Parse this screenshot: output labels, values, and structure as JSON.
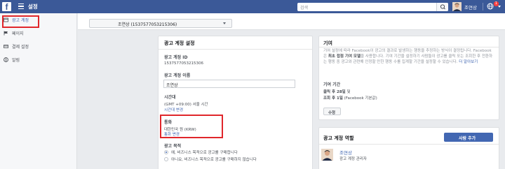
{
  "topbar": {
    "logo": "f",
    "title": "설정",
    "search_placeholder": "검색",
    "user_name": "조연상",
    "notification_count": "1",
    "brand_color": "#3b5998"
  },
  "sidebar": {
    "items": [
      {
        "label": "광고 계정",
        "icon": "ad-account-icon"
      },
      {
        "label": "페이지",
        "icon": "flag-icon"
      },
      {
        "label": "결제 설정",
        "icon": "payment-icon"
      },
      {
        "label": "알림",
        "icon": "globe-icon"
      }
    ],
    "highlight_color": "#e0262b"
  },
  "account_selector": {
    "label": "조연상 (1537577053215306)"
  },
  "account_settings": {
    "title": "광고 계정 설정",
    "account_id_label": "광고 계정 ID",
    "account_id_value": "1537577053215306",
    "account_name_label": "광고 계정 이름",
    "account_name_value": "조연상",
    "timezone_label": "시간대",
    "timezone_value": "(GMT +09:00) 서울 시간",
    "timezone_link": "시간대 변경",
    "currency_label": "통화",
    "currency_value": "대한민국 원 (KRW)",
    "currency_link": "통화 변경",
    "purpose_label": "광고 목적",
    "purpose_options": [
      "예, 비즈니스 목적으로 광고를 구매합니다",
      "아니요, 비즈니스 목적으로 광고를 구매하지 않습니다"
    ],
    "purpose_selected": 0
  },
  "attribution": {
    "title": "기여",
    "description_before": "기여 설정에 따라 Facebook이 광고의 결과로 발생하는 행동을 추정하는 방식이 결정됩니다. Facebook은 ",
    "description_bold": "최초 접점 기여 모델",
    "description_after": "을 사용합니다. 기여 기간을 설정하기 사람들이 광고를 클릭 또는 조회한 후 전환하는 행동 중 광고와 관련해 인정할 만한 행동 수를 집계할 기간을 설정할 수 있습니다.",
    "description_link": "더 알아보기",
    "window_label": "기여 기간",
    "click_line_bold": "클릭 후 28일",
    "click_line_rest": " 및",
    "view_line_bold": "조회 후 1일",
    "view_line_rest": " (Facebook 기본값)",
    "edit_button": "수정"
  },
  "roles": {
    "title": "광고 계정 역할",
    "add_button": "사람 추가",
    "members": [
      {
        "name": "조연상",
        "role": "광고 계정 관리자"
      }
    ],
    "button_color": "#4267b2"
  }
}
